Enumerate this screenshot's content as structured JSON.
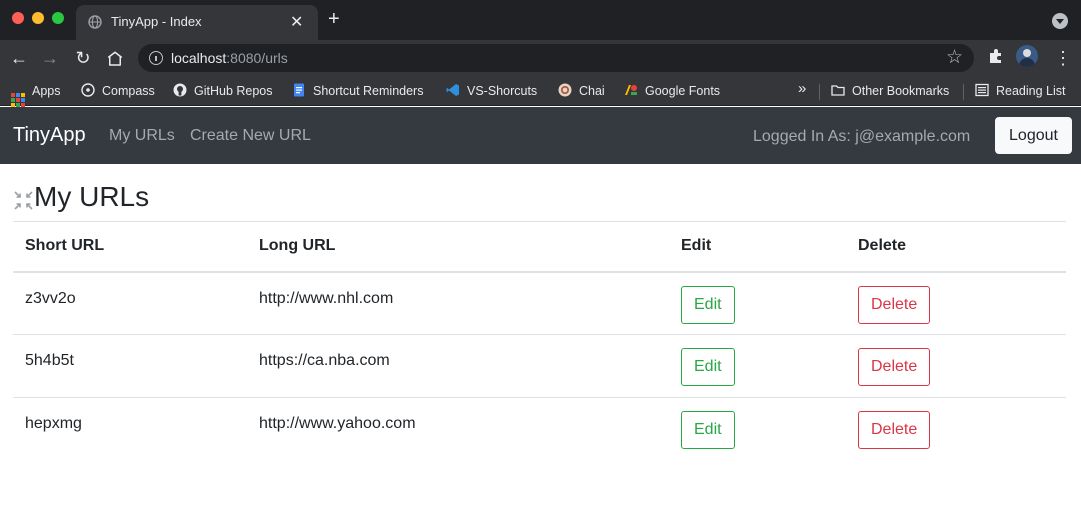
{
  "browser": {
    "tab_title": "TinyApp - Index",
    "url_host": "localhost",
    "url_rest": ":8080/urls",
    "bookmarks": [
      {
        "label": "Apps",
        "icon": "apps-grid-icon"
      },
      {
        "label": "Compass",
        "icon": "compass-icon"
      },
      {
        "label": "GitHub Repos",
        "icon": "github-icon"
      },
      {
        "label": "Shortcut Reminders",
        "icon": "docs-icon"
      },
      {
        "label": "VS-Shorcuts",
        "icon": "vscode-icon"
      },
      {
        "label": "Chai",
        "icon": "chai-icon"
      },
      {
        "label": "Google Fonts",
        "icon": "google-fonts-icon"
      }
    ],
    "overflow_chevron": "»",
    "other_bookmarks": "Other Bookmarks",
    "reading_list": "Reading List"
  },
  "navbar": {
    "brand": "TinyApp",
    "links": [
      "My URLs",
      "Create New URL"
    ],
    "logged_in": "Logged In As: j@example.com",
    "logout": "Logout"
  },
  "main": {
    "title": "My URLs",
    "columns": [
      "Short URL",
      "Long URL",
      "Edit",
      "Delete"
    ],
    "rows": [
      {
        "short": "z3vv2o",
        "long": "http://www.nhl.com",
        "edit": "Edit",
        "delete": "Delete"
      },
      {
        "short": "5h4b5t",
        "long": "https://ca.nba.com",
        "edit": "Edit",
        "delete": "Delete"
      },
      {
        "short": "hepxmg",
        "long": "http://www.yahoo.com",
        "edit": "Edit",
        "delete": "Delete"
      }
    ]
  },
  "colors": {
    "navbar_bg": "#343a40",
    "edit_green": "#28a745",
    "delete_red": "#dc3545"
  }
}
